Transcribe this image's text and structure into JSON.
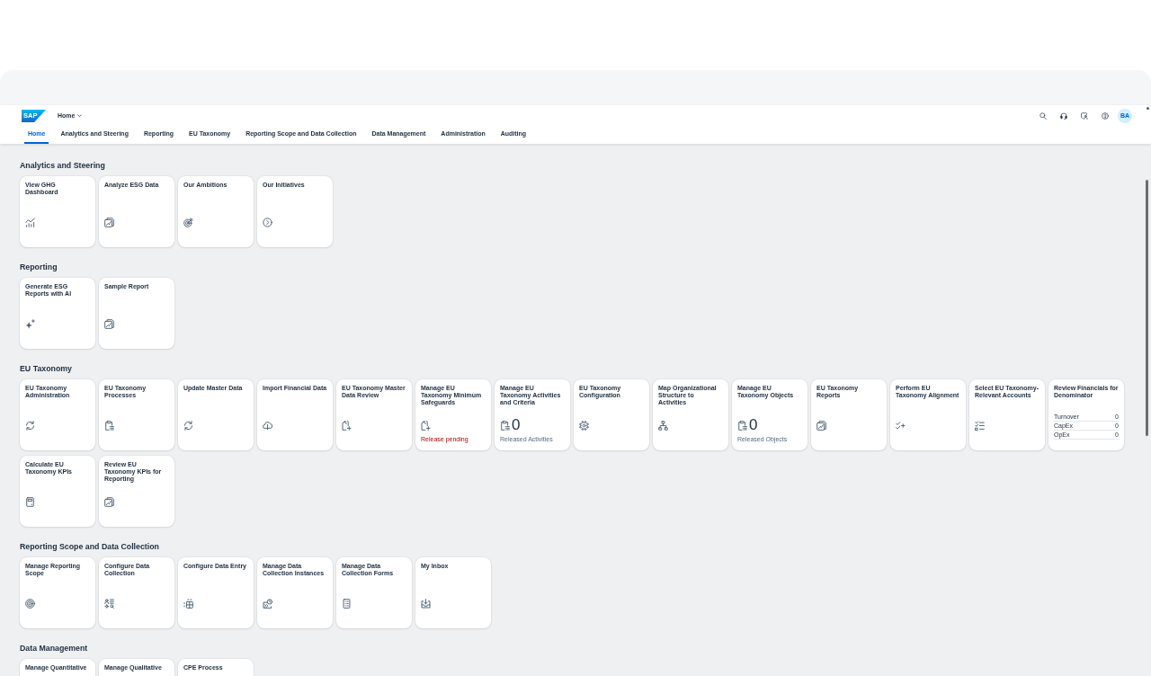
{
  "header": {
    "logo": "SAP",
    "space": "Home",
    "tabs": [
      {
        "label": "Home",
        "selected": true
      },
      {
        "label": "Analytics and Steering",
        "selected": false
      },
      {
        "label": "Reporting",
        "selected": false
      },
      {
        "label": "EU Taxonomy",
        "selected": false
      },
      {
        "label": "Reporting Scope and Data Collection",
        "selected": false
      },
      {
        "label": "Data Management",
        "selected": false
      },
      {
        "label": "Administration",
        "selected": false
      },
      {
        "label": "Auditing",
        "selected": false
      }
    ],
    "avatar": "BA"
  },
  "sections": [
    {
      "title": "Analytics and Steering",
      "tiles": [
        {
          "kind": "launch",
          "title": "View GHG Dashboard"
        },
        {
          "kind": "launch",
          "title": "Analyze ESG Data"
        },
        {
          "kind": "launch",
          "title": "Our Ambitions"
        },
        {
          "kind": "launch",
          "title": "Our Initiatives"
        }
      ]
    },
    {
      "title": "Reporting",
      "tiles": [
        {
          "kind": "launch",
          "title": "Generate ESG Reports with AI"
        },
        {
          "kind": "launch",
          "title": "Sample Report"
        }
      ]
    },
    {
      "title": "EU Taxonomy",
      "tiles": [
        {
          "kind": "launch",
          "title": "EU Taxonomy Administration"
        },
        {
          "kind": "launch",
          "title": "EU Taxonomy Processes"
        },
        {
          "kind": "launch",
          "title": "Update Master Data"
        },
        {
          "kind": "launch",
          "title": "Import Financial Data"
        },
        {
          "kind": "launch",
          "title": "EU Taxonomy Master Data Review"
        },
        {
          "kind": "status",
          "title": "Manage EU Taxonomy Minimum Safeguards",
          "status": "Release pending"
        },
        {
          "kind": "count",
          "title": "Manage EU Taxonomy Activities and Criteria",
          "count": "0",
          "caption": "Released Activities"
        },
        {
          "kind": "launch",
          "title": "EU Taxonomy Configuration"
        },
        {
          "kind": "launch",
          "title": "Map Organizational Structure to Activities"
        },
        {
          "kind": "count",
          "title": "Manage EU Taxonomy Objects",
          "count": "0",
          "caption": "Released Objects"
        },
        {
          "kind": "launch",
          "title": "EU Taxonomy Reports"
        },
        {
          "kind": "launch",
          "title": "Perform EU Taxonomy Alignment"
        },
        {
          "kind": "launch",
          "title": "Select EU Taxonomy-Relevant Accounts"
        },
        {
          "kind": "table",
          "title": "Review Financials for Denominator",
          "rows": [
            {
              "label": "Turnover",
              "value": "0"
            },
            {
              "label": "CapEx",
              "value": "0"
            },
            {
              "label": "OpEx",
              "value": "0"
            }
          ]
        },
        {
          "kind": "launch",
          "title": "Calculate EU Taxonomy KPIs"
        },
        {
          "kind": "launch",
          "title": "Review EU Taxonomy KPIs for Reporting"
        }
      ]
    },
    {
      "title": "Reporting Scope and Data Collection",
      "tiles": [
        {
          "kind": "launch",
          "title": "Manage Reporting Scope"
        },
        {
          "kind": "launch",
          "title": "Configure Data Collection"
        },
        {
          "kind": "launch",
          "title": "Configure Data Entry"
        },
        {
          "kind": "launch",
          "title": "Manage Data Collection Instances"
        },
        {
          "kind": "launch",
          "title": "Manage Data Collection Forms"
        },
        {
          "kind": "launch",
          "title": "My Inbox"
        }
      ]
    },
    {
      "title": "Data Management",
      "tiles": [
        {
          "kind": "launch",
          "title": "Manage Quantitative"
        },
        {
          "kind": "launch",
          "title": "Manage Qualitative"
        },
        {
          "kind": "launch",
          "title": "CPE Process"
        }
      ]
    }
  ]
}
